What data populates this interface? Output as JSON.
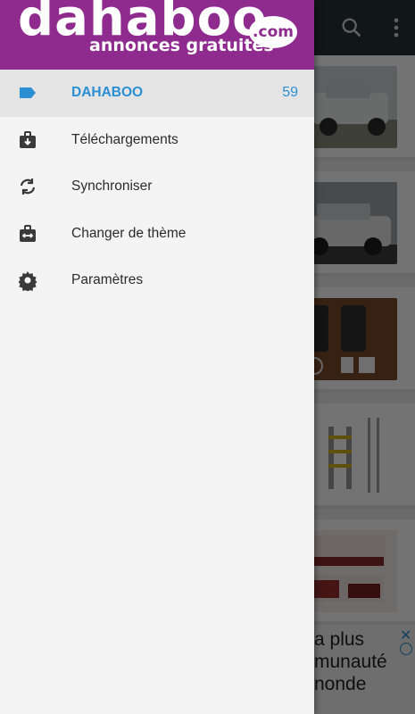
{
  "drawer": {
    "logo": {
      "main": "dahaboo",
      "com": ".com",
      "tagline": "annonces gratuites"
    },
    "items": [
      {
        "label": "DAHABOO",
        "count": "59",
        "icon": "label-icon",
        "active": true
      },
      {
        "label": "Téléchargements",
        "icon": "download-icon"
      },
      {
        "label": "Synchroniser",
        "icon": "sync-icon"
      },
      {
        "label": "Changer de thème",
        "icon": "swap-theme-icon"
      },
      {
        "label": "Paramètres",
        "icon": "settings-gear-icon"
      }
    ]
  },
  "background": {
    "ad_text": "a plus\nmunauté\nnonde"
  },
  "colors": {
    "brand": "#8f2b8f",
    "accent": "#2b8fd3",
    "toolbar": "#263238"
  }
}
